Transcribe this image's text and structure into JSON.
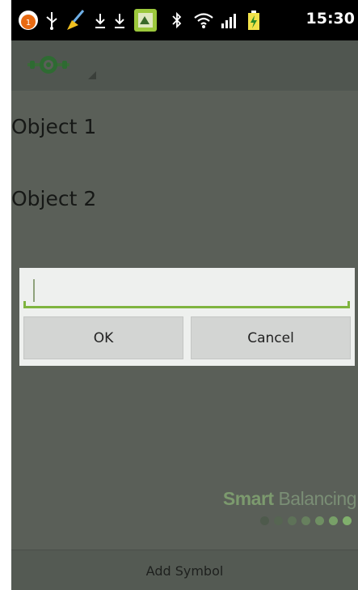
{
  "status_bar": {
    "time": "15:30",
    "notification_count": "1",
    "icons": [
      "notification-count-icon",
      "usb-icon",
      "broom-icon",
      "download-icon",
      "download-icon",
      "app-icon",
      "bluetooth-icon",
      "wifi-icon",
      "signal-icon",
      "battery-charging-icon"
    ]
  },
  "action_bar": {
    "logo_icon": "app-logo-icon"
  },
  "list": {
    "items": [
      "Object 1",
      "Object 2"
    ]
  },
  "dialog": {
    "input_value": "",
    "ok_label": "OK",
    "cancel_label": "Cancel"
  },
  "watermark": {
    "bold": "Smart",
    "regular": "Balancing"
  },
  "bottom_bar": {
    "label": "Add Symbol"
  },
  "colors": {
    "background": "#5a5f58",
    "accent": "#7fb43f",
    "dialog": "#eef0ee"
  }
}
